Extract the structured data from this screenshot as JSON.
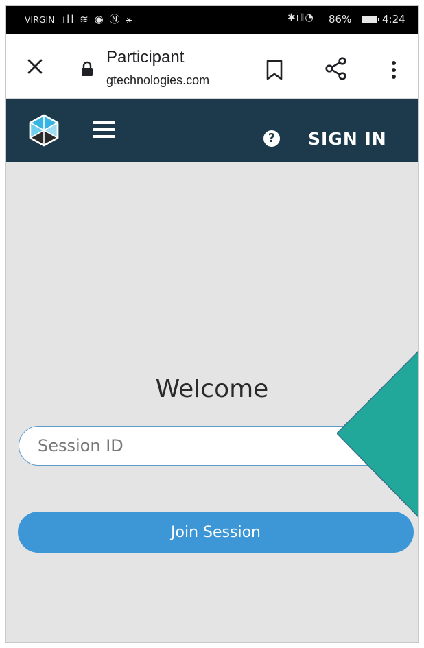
{
  "status_bar": {
    "carrier": "VIRGIN",
    "left_icons": "ıll ≋ ◉ Ⓝ ⚹",
    "right_icons": "✱ıⅡ◔",
    "battery": "86%",
    "time": "4:24"
  },
  "browser": {
    "page_title": "Participant",
    "url": "gtechnologies.com",
    "icons": [
      "close-icon",
      "lock-icon",
      "bookmark-icon",
      "share-icon",
      "more-vert-icon"
    ]
  },
  "header": {
    "help_symbol": "?",
    "sign_in_label": "SIGN IN",
    "colors": {
      "background": "#1d3a4c",
      "text": "#ffffff"
    }
  },
  "main": {
    "welcome": "Welcome",
    "session_placeholder": "Session ID",
    "join_button": "Join Session",
    "colors": {
      "background": "#e4e4e4",
      "button": "#3d96d5",
      "input_border": "#5c9ac8"
    }
  },
  "annotation": {
    "callout_color": "#21a89a"
  }
}
